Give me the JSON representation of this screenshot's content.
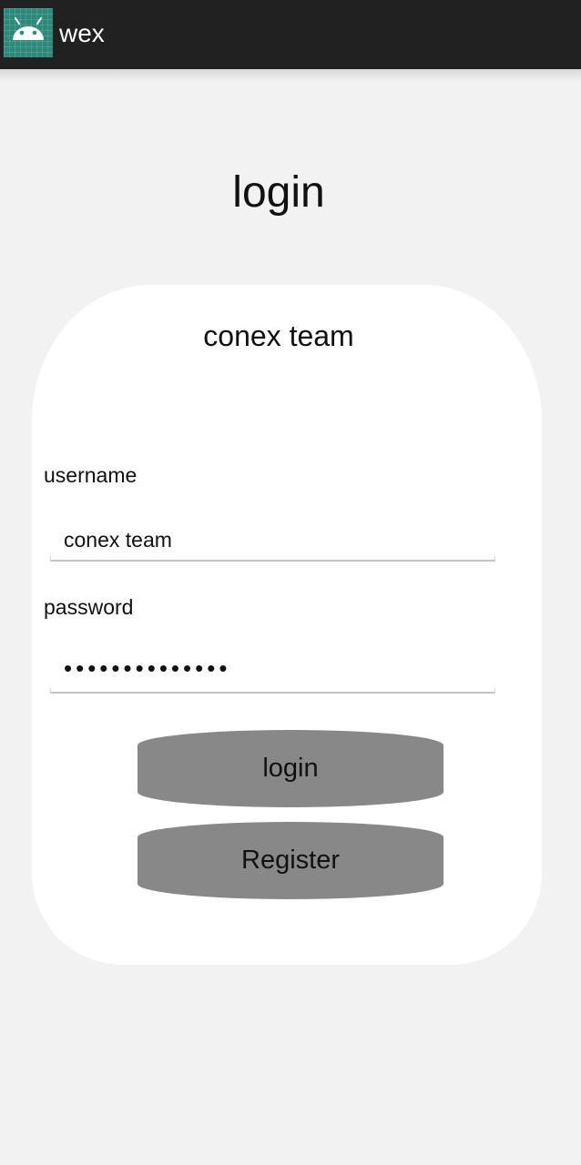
{
  "appbar": {
    "icon": "android-icon",
    "title": "wex"
  },
  "page": {
    "title": "login"
  },
  "card": {
    "title": "conex team",
    "username": {
      "label": "username",
      "value": "conex team"
    },
    "password": {
      "label": "password",
      "value": "••••••••••••••"
    },
    "login_button": "login",
    "register_button": "Register"
  },
  "colors": {
    "appbar": "#212121",
    "background": "#f2f2f2",
    "card": "#ffffff",
    "button": "#888888",
    "icon_bg": "#2d8a7b"
  }
}
